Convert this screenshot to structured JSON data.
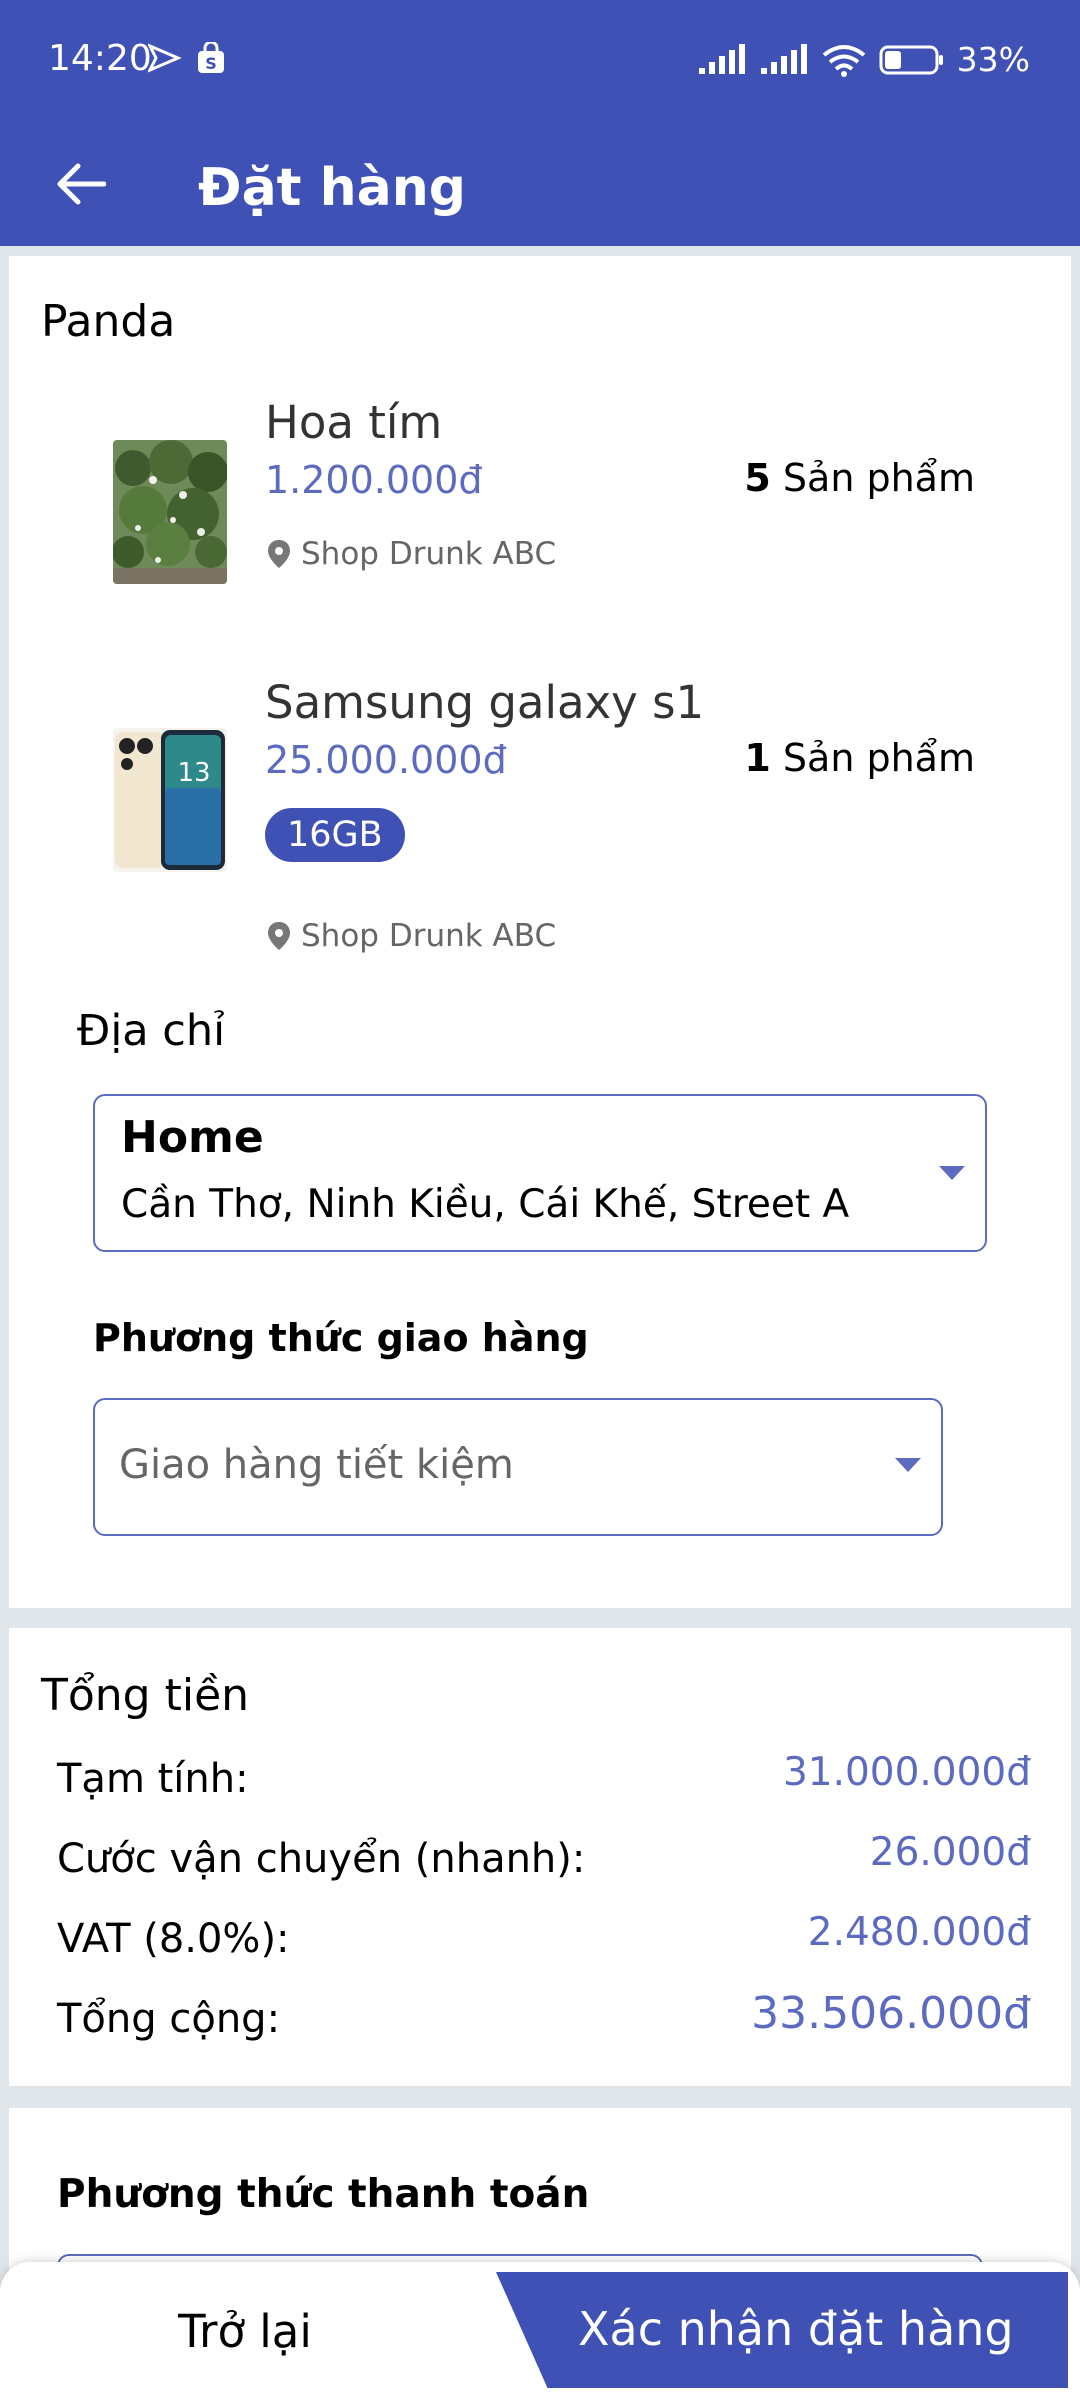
{
  "status_bar": {
    "time": "14:20",
    "battery": "33%",
    "icons": [
      "send-icon",
      "shop-bag-icon",
      "signal-icon",
      "signal-icon",
      "wifi-icon",
      "battery-icon"
    ]
  },
  "app_bar": {
    "title": "Đặt hàng",
    "back_icon": "arrow-left-icon"
  },
  "order": {
    "shop_name": "Panda",
    "products": [
      {
        "name": "Hoa tím",
        "price": "1.200.000đ",
        "quantity": "5",
        "quantity_unit": " Sản phẩm",
        "shop": "Shop Drunk ABC",
        "thumbnail": "flower-plant-photo"
      },
      {
        "name": "Samsung galaxy s1",
        "price": "25.000.000đ",
        "quantity": "1",
        "quantity_unit": " Sản phẩm",
        "variant": "16GB",
        "shop": "Shop Drunk ABC",
        "thumbnail": "smartphone-photo",
        "screen_label": "13"
      }
    ],
    "address": {
      "label": "Địa chỉ",
      "selected_title": "Home",
      "selected_detail": "Cần Thơ, Ninh Kiều, Cái Khế, Street A"
    },
    "shipping": {
      "label": "Phương thức giao hàng",
      "selected": "Giao hàng tiết kiệm"
    }
  },
  "totals": {
    "title": "Tổng tiền",
    "subtotal_label": "Tạm tính:",
    "subtotal_value": "31.000.000đ",
    "shipping_label": "Cước vận chuyển (nhanh):",
    "shipping_value": "26.000đ",
    "vat_label": "VAT (8.0%):",
    "vat_value": "2.480.000đ",
    "grand_total_label": "Tổng cộng:",
    "grand_total_value": "33.506.000đ"
  },
  "payment": {
    "label": "Phương thức thanh toán"
  },
  "actions": {
    "back_label": "Trở lại",
    "confirm_label": "Xác nhận đặt hàng"
  },
  "colors": {
    "primary": "#3f51b5",
    "accent_text": "#5c6bc0",
    "background": "#e1e6eb"
  }
}
